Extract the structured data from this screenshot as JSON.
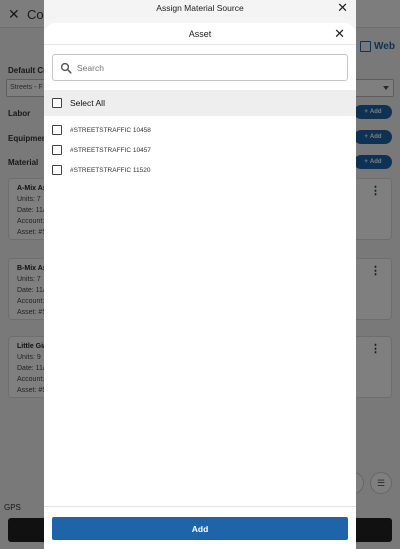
{
  "background": {
    "title": "Co",
    "web_link": "Web",
    "default_crew_label": "Default Cr",
    "default_crew_value": "Streets - F",
    "labor_label": "Labor",
    "equipment_label": "Equipment",
    "material_label": "Material",
    "add_label": "Add",
    "materials": [
      {
        "title": "A-Mix As",
        "units": "Units: 7",
        "date": "Date: 11/",
        "account": "Account:",
        "asset": "Asset: #S"
      },
      {
        "title": "B-Mix As",
        "units": "Units: 7",
        "date": "Date: 11/",
        "account": "Account:",
        "asset": "Asset: #S"
      },
      {
        "title": "Little Gia",
        "units": "Units: 9",
        "date": "Date: 11/",
        "account": "Account:",
        "asset": "Asset: #S"
      }
    ],
    "gps_label": "GPS"
  },
  "outer_sheet": {
    "title": "Assign Material Source"
  },
  "asset_modal": {
    "title": "Asset",
    "search": {
      "placeholder": "Search",
      "value": ""
    },
    "select_all_label": "Select All",
    "assets": [
      {
        "label": "#STREETSTRAFFIC 10458",
        "checked": false
      },
      {
        "label": "#STREETSTRAFFIC 10457",
        "checked": false
      },
      {
        "label": "#STREETSTRAFFIC 11520",
        "checked": false
      }
    ],
    "add_button_label": "Add"
  },
  "colors": {
    "primary": "#1d64a8",
    "scrim": "rgba(0,0,0,0.5)"
  }
}
